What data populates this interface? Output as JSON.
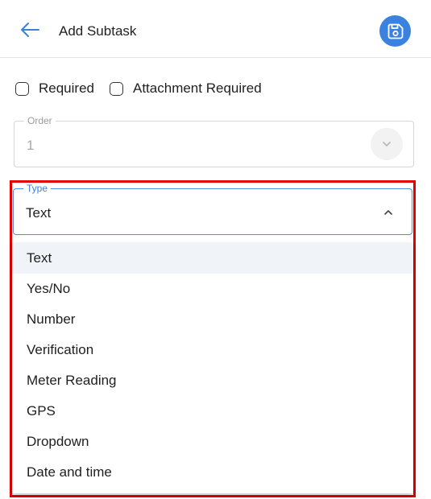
{
  "header": {
    "title": "Add Subtask",
    "back_icon": "arrow-left-icon",
    "save_icon": "floppy-disk-icon",
    "accent_color": "#3b82e0"
  },
  "checkboxes": [
    {
      "label": "Required",
      "checked": false
    },
    {
      "label": "Attachment Required",
      "checked": false
    }
  ],
  "order_field": {
    "label": "Order",
    "value": "1",
    "disabled": true
  },
  "type_field": {
    "label": "Type",
    "value": "Text",
    "expanded": true,
    "options": [
      "Text",
      "Yes/No",
      "Number",
      "Verification",
      "Meter Reading",
      "GPS",
      "Dropdown",
      "Date and time"
    ],
    "selected_index": 0
  },
  "highlight_color": "#e30000"
}
